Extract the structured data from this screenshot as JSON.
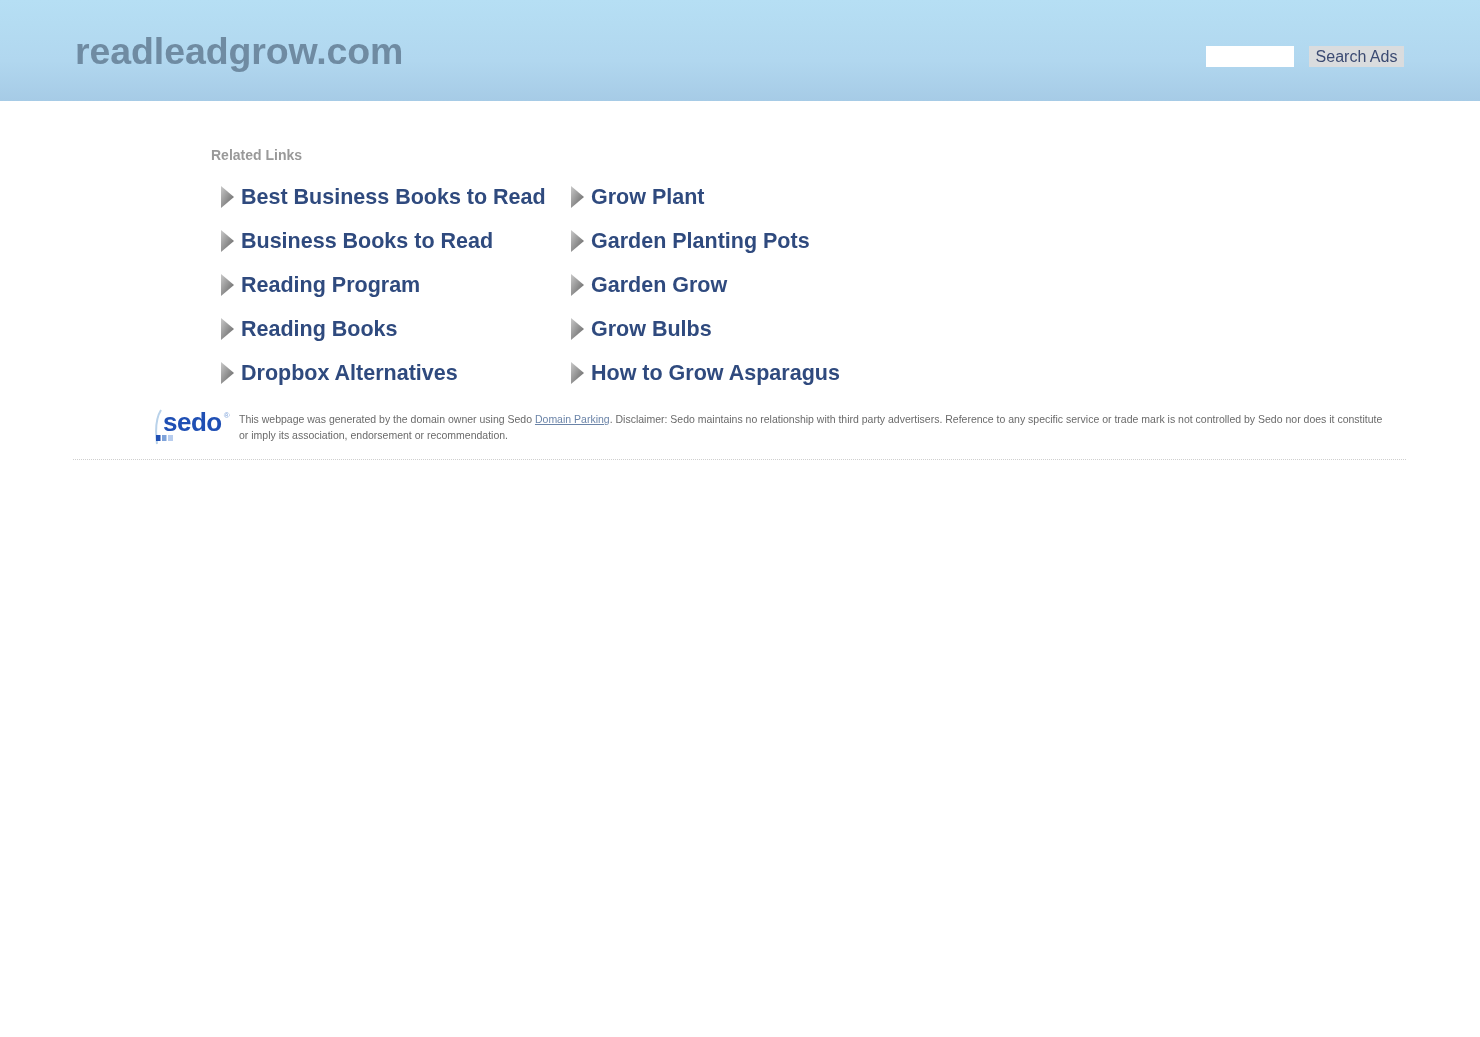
{
  "header": {
    "site_title": "readleadgrow.com",
    "search_button": "Search Ads"
  },
  "related_links": {
    "heading": "Related Links",
    "columns": [
      {
        "links": [
          "Best Business Books to Read",
          "Business Books to Read",
          "Reading Program",
          "Reading Books",
          "Dropbox Alternatives"
        ]
      },
      {
        "links": [
          "Grow Plant",
          "Garden Planting Pots",
          "Garden Grow",
          "Grow Bulbs",
          "How to Grow Asparagus"
        ]
      }
    ]
  },
  "footer": {
    "logo": {
      "text": "sedo",
      "mark": "®"
    },
    "disclaimer": {
      "before": "This webpage was generated by the domain owner using Sedo",
      "link": "Domain Parking",
      "after": ". Disclaimer: Sedo maintains no relationship with third party advertisers. Reference to any specific service or trade mark is not controlled by Sedo nor does it constitute or imply its association, endorsement or recommendation."
    }
  }
}
